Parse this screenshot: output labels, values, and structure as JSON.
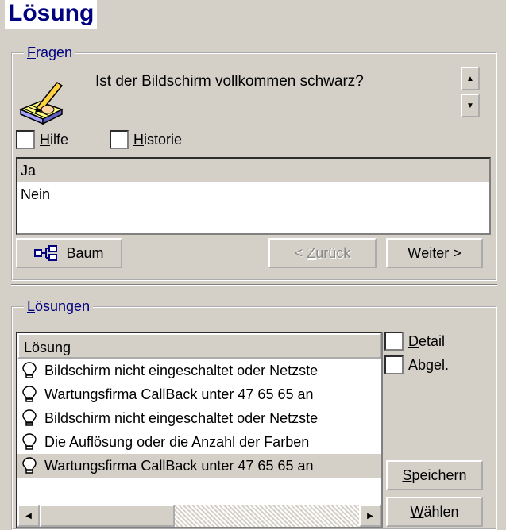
{
  "title": "Lösung",
  "fragen": {
    "legend_pre": "",
    "legend_hot": "F",
    "legend_post": "ragen",
    "icon": "book-pencil-icon",
    "question": "Ist der Bildschirm vollkommen schwarz?",
    "hilfe": {
      "hot": "H",
      "rest": "ilfe"
    },
    "historie": {
      "hot": "H",
      "rest": "istorie"
    },
    "answers": [
      "Ja",
      "Nein"
    ],
    "baum": {
      "hot": "B",
      "rest": "aum"
    },
    "zuruck": {
      "pre": "< ",
      "hot": "Z",
      "rest": "urück"
    },
    "weiter": {
      "hot": "W",
      "rest": "eiter >"
    }
  },
  "loesungen": {
    "legend_hot": "L",
    "legend_rest": "ösungen",
    "column_header": "Lösung",
    "rows": [
      "Bildschirm nicht eingeschaltet oder Netzste",
      "Wartungsfirma CallBack unter 47 65 65 an",
      "Bildschirm nicht eingeschaltet oder Netzste",
      "Die Auflösung oder die Anzahl der Farben",
      "Wartungsfirma CallBack unter 47 65 65 an"
    ],
    "detail": {
      "hot": "D",
      "rest": "etail"
    },
    "abgel": {
      "hot": "A",
      "rest": "bgel."
    },
    "speichern": {
      "hot": "S",
      "rest": "peichern"
    },
    "waehlen": {
      "hot": "W",
      "rest": "ählen"
    }
  }
}
